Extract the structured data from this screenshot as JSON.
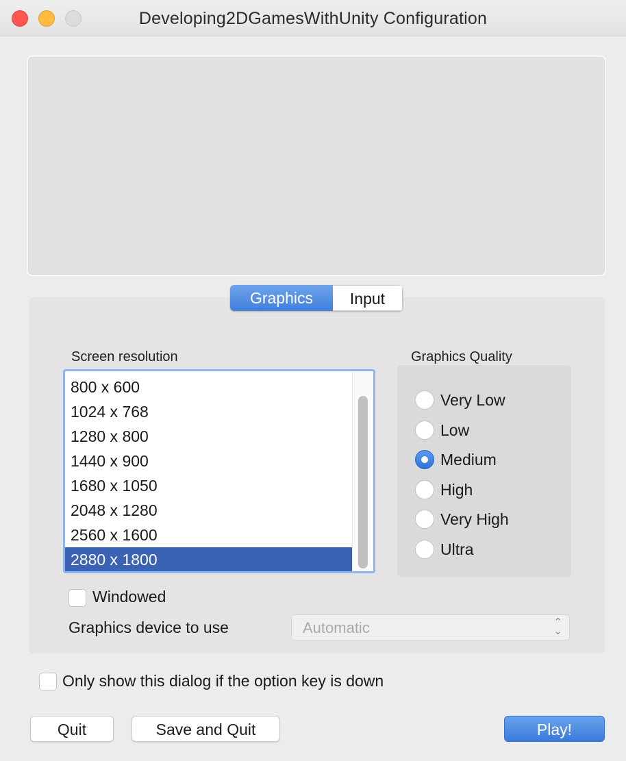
{
  "window": {
    "title": "Developing2DGamesWithUnity Configuration"
  },
  "tabs": [
    {
      "label": "Graphics",
      "active": true
    },
    {
      "label": "Input",
      "active": false
    }
  ],
  "graphics": {
    "resolution_label": "Screen resolution",
    "resolutions": [
      "800 x 600",
      "1024 x 768",
      "1280 x 800",
      "1440 x 900",
      "1680 x 1050",
      "2048 x 1280",
      "2560 x 1600",
      "2880 x 1800"
    ],
    "selected_resolution": "2880 x 1800",
    "quality_label": "Graphics Quality",
    "quality_options": [
      "Very Low",
      "Low",
      "Medium",
      "High",
      "Very High",
      "Ultra"
    ],
    "selected_quality": "Medium",
    "windowed_label": "Windowed",
    "windowed_checked": false,
    "device_label": "Graphics device to use",
    "device_value": "Automatic"
  },
  "footer": {
    "option_key_label": "Only show this dialog if the option key is down",
    "option_key_checked": false,
    "quit_label": "Quit",
    "save_quit_label": "Save and Quit",
    "play_label": "Play!"
  },
  "colors": {
    "accent": "#3f7fdc",
    "selection": "#3a63b6",
    "close": "#fc5753",
    "minimize": "#fdbc40",
    "zoom_disabled": "#dcdcdc"
  }
}
